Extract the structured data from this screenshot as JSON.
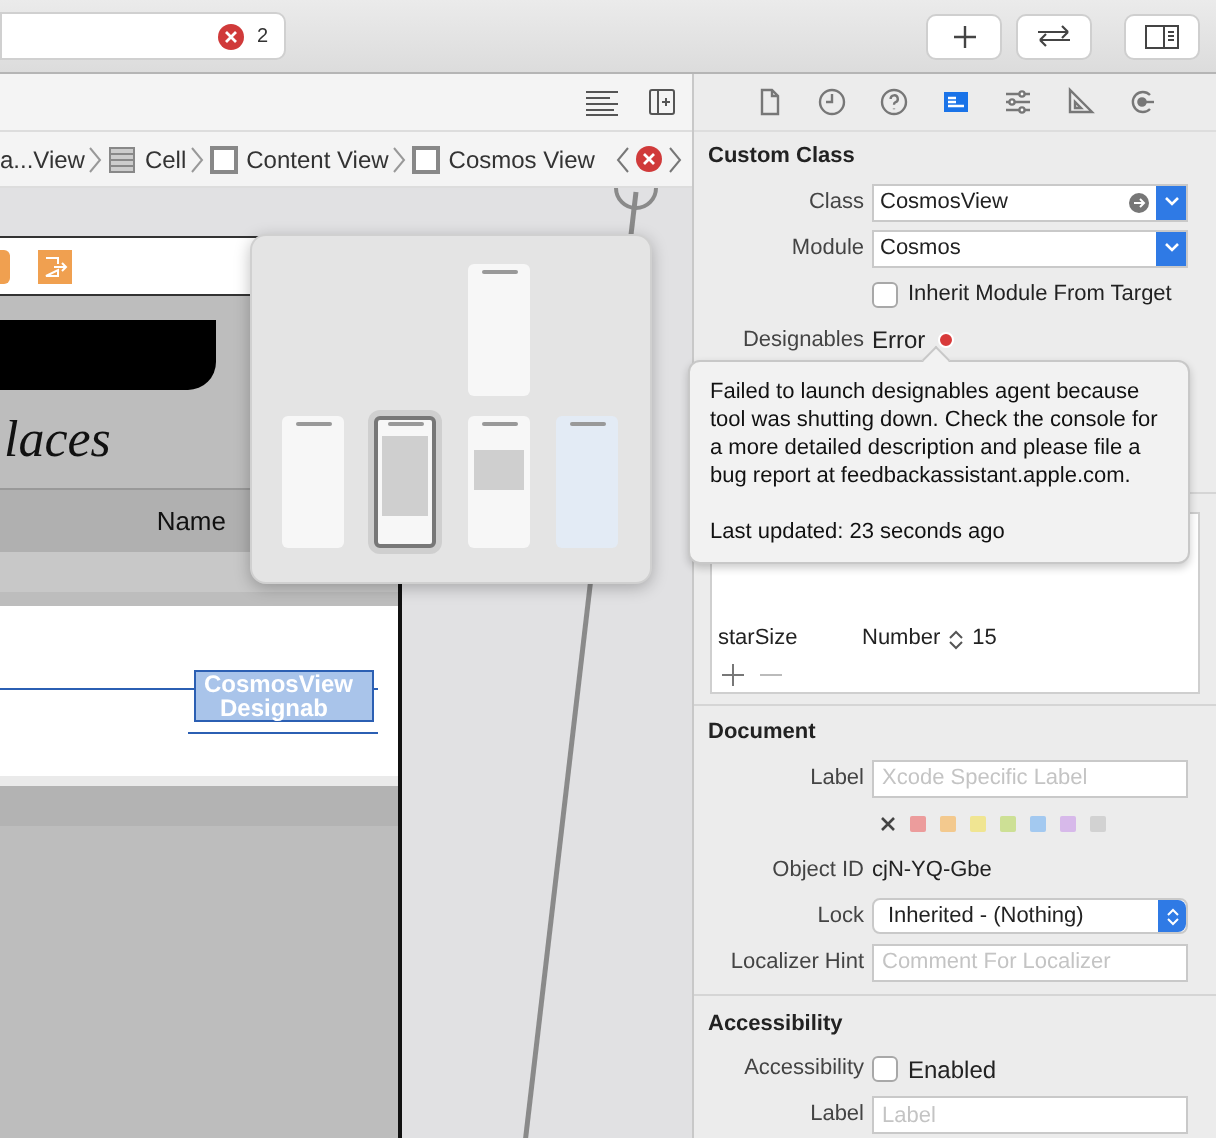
{
  "toolbar": {
    "issue_count": "2"
  },
  "breadcrumb": {
    "items": [
      "a...View",
      "Cell",
      "Content View",
      "Cosmos View"
    ]
  },
  "canvas": {
    "title": "laces",
    "column_header": "Name",
    "selected_view_labels": [
      "CosmosView",
      "Designab"
    ]
  },
  "scene_picker": {
    "thumbnails": [
      {
        "kind": "top",
        "selected": false
      },
      {
        "kind": "plain",
        "selected": false
      },
      {
        "kind": "table",
        "selected": true
      },
      {
        "kind": "detail",
        "selected": false
      },
      {
        "kind": "tinted",
        "selected": false
      }
    ]
  },
  "inspector_tabs": [
    {
      "kind": "file",
      "selected": false
    },
    {
      "kind": "history",
      "selected": false
    },
    {
      "kind": "help",
      "selected": false
    },
    {
      "kind": "identity",
      "selected": true
    },
    {
      "kind": "attributes",
      "selected": false
    },
    {
      "kind": "size",
      "selected": false
    },
    {
      "kind": "connections",
      "selected": false
    }
  ],
  "custom_class": {
    "title": "Custom Class",
    "class_label": "Class",
    "class_value": "CosmosView",
    "module_label": "Module",
    "module_value": "Cosmos",
    "inherit_label": "Inherit Module From Target",
    "inherit_checked": false,
    "designables_label": "Designables",
    "designables_value": "Error"
  },
  "tooltip": {
    "message": "Failed to launch designables agent because tool was shutting down. Check the console for a more detailed description and please file a bug report at feedbackassistant.apple.com.",
    "last_updated": "Last updated: 23 seconds ago"
  },
  "runtime_attributes": [
    {
      "key": "starSize",
      "type": "Number",
      "value": "15"
    }
  ],
  "document": {
    "title": "Document",
    "label_label": "Label",
    "label_placeholder": "Xcode Specific Label",
    "colors": [
      {
        "color": "#ec9c9c",
        "selected": false
      },
      {
        "color": "#f3c98e",
        "selected": false
      },
      {
        "color": "#f0e592",
        "selected": false
      },
      {
        "color": "#cde095",
        "selected": false
      },
      {
        "color": "#a3c9f0",
        "selected": false
      },
      {
        "color": "#d7b9ea",
        "selected": false
      },
      {
        "color": "#d2d2d2",
        "selected": false
      }
    ],
    "object_id_label": "Object ID",
    "object_id": "cjN-YQ-Gbe",
    "lock_label": "Lock",
    "lock_value": "Inherited - (Nothing)",
    "hint_label": "Localizer Hint",
    "hint_placeholder": "Comment For Localizer"
  },
  "accessibility": {
    "title": "Accessibility",
    "accessibility_label": "Accessibility",
    "enabled_label": "Enabled",
    "enabled_checked": false,
    "label_label": "Label",
    "label_placeholder": "Label"
  }
}
